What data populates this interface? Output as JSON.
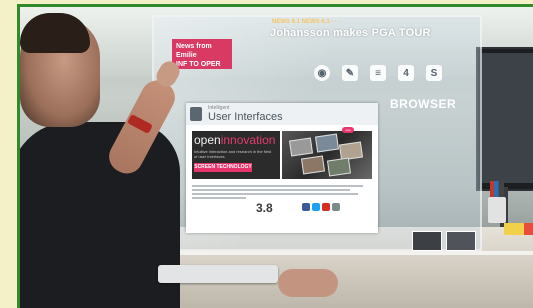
{
  "photo": {
    "description_alt": ""
  },
  "overlay": {
    "news_chip": "News from Emilie\nINF TO OPER",
    "ticker_small": "NEWS 6.1 NEWS 6.1 · · ·",
    "ticker_big": "Johansson makes PGA TOUR",
    "icons": [
      {
        "name": "globe-icon",
        "glyph": "◉"
      },
      {
        "name": "pen-icon",
        "glyph": "✎"
      },
      {
        "name": "list-icon",
        "glyph": "≡"
      },
      {
        "name": "four-icon",
        "glyph": "4"
      },
      {
        "name": "s-icon",
        "glyph": "S"
      }
    ],
    "browser_label": "BROWSER"
  },
  "document": {
    "header_sub": "Intelligent",
    "header_title": "User Interfaces",
    "hero_title_a": "open",
    "hero_title_b": "innovation",
    "hero_text": "Intuitive interaction and research in the field of user interfaces",
    "screen_button": "SCREEN TECHNOLOGY",
    "new_badge": "new",
    "rating": "3.8"
  },
  "colors": {
    "accent_pink": "#e8346c",
    "ticker_gold": "#f7c46a"
  }
}
